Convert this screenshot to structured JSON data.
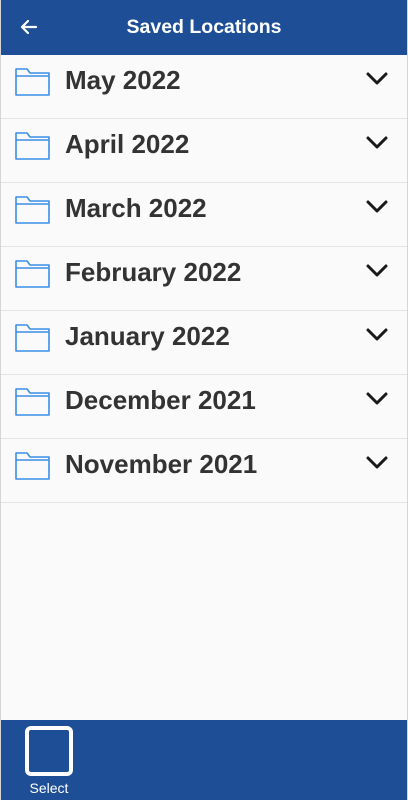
{
  "header": {
    "title": "Saved Locations",
    "back_icon": "arrow-left-icon"
  },
  "folders": [
    {
      "label": "May 2022",
      "icon": "folder-icon",
      "toggle_icon": "chevron-down-icon"
    },
    {
      "label": "April 2022",
      "icon": "folder-icon",
      "toggle_icon": "chevron-down-icon"
    },
    {
      "label": "March 2022",
      "icon": "folder-icon",
      "toggle_icon": "chevron-down-icon"
    },
    {
      "label": "February 2022",
      "icon": "folder-icon",
      "toggle_icon": "chevron-down-icon"
    },
    {
      "label": "January 2022",
      "icon": "folder-icon",
      "toggle_icon": "chevron-down-icon"
    },
    {
      "label": "December 2021",
      "icon": "folder-icon",
      "toggle_icon": "chevron-down-icon"
    },
    {
      "label": "November 2021",
      "icon": "folder-icon",
      "toggle_icon": "chevron-down-icon"
    }
  ],
  "bottom_bar": {
    "select_label": "Select"
  },
  "colors": {
    "primary": "#1e4f96",
    "folder_outline": "#3a8ee6",
    "text": "#333333"
  }
}
